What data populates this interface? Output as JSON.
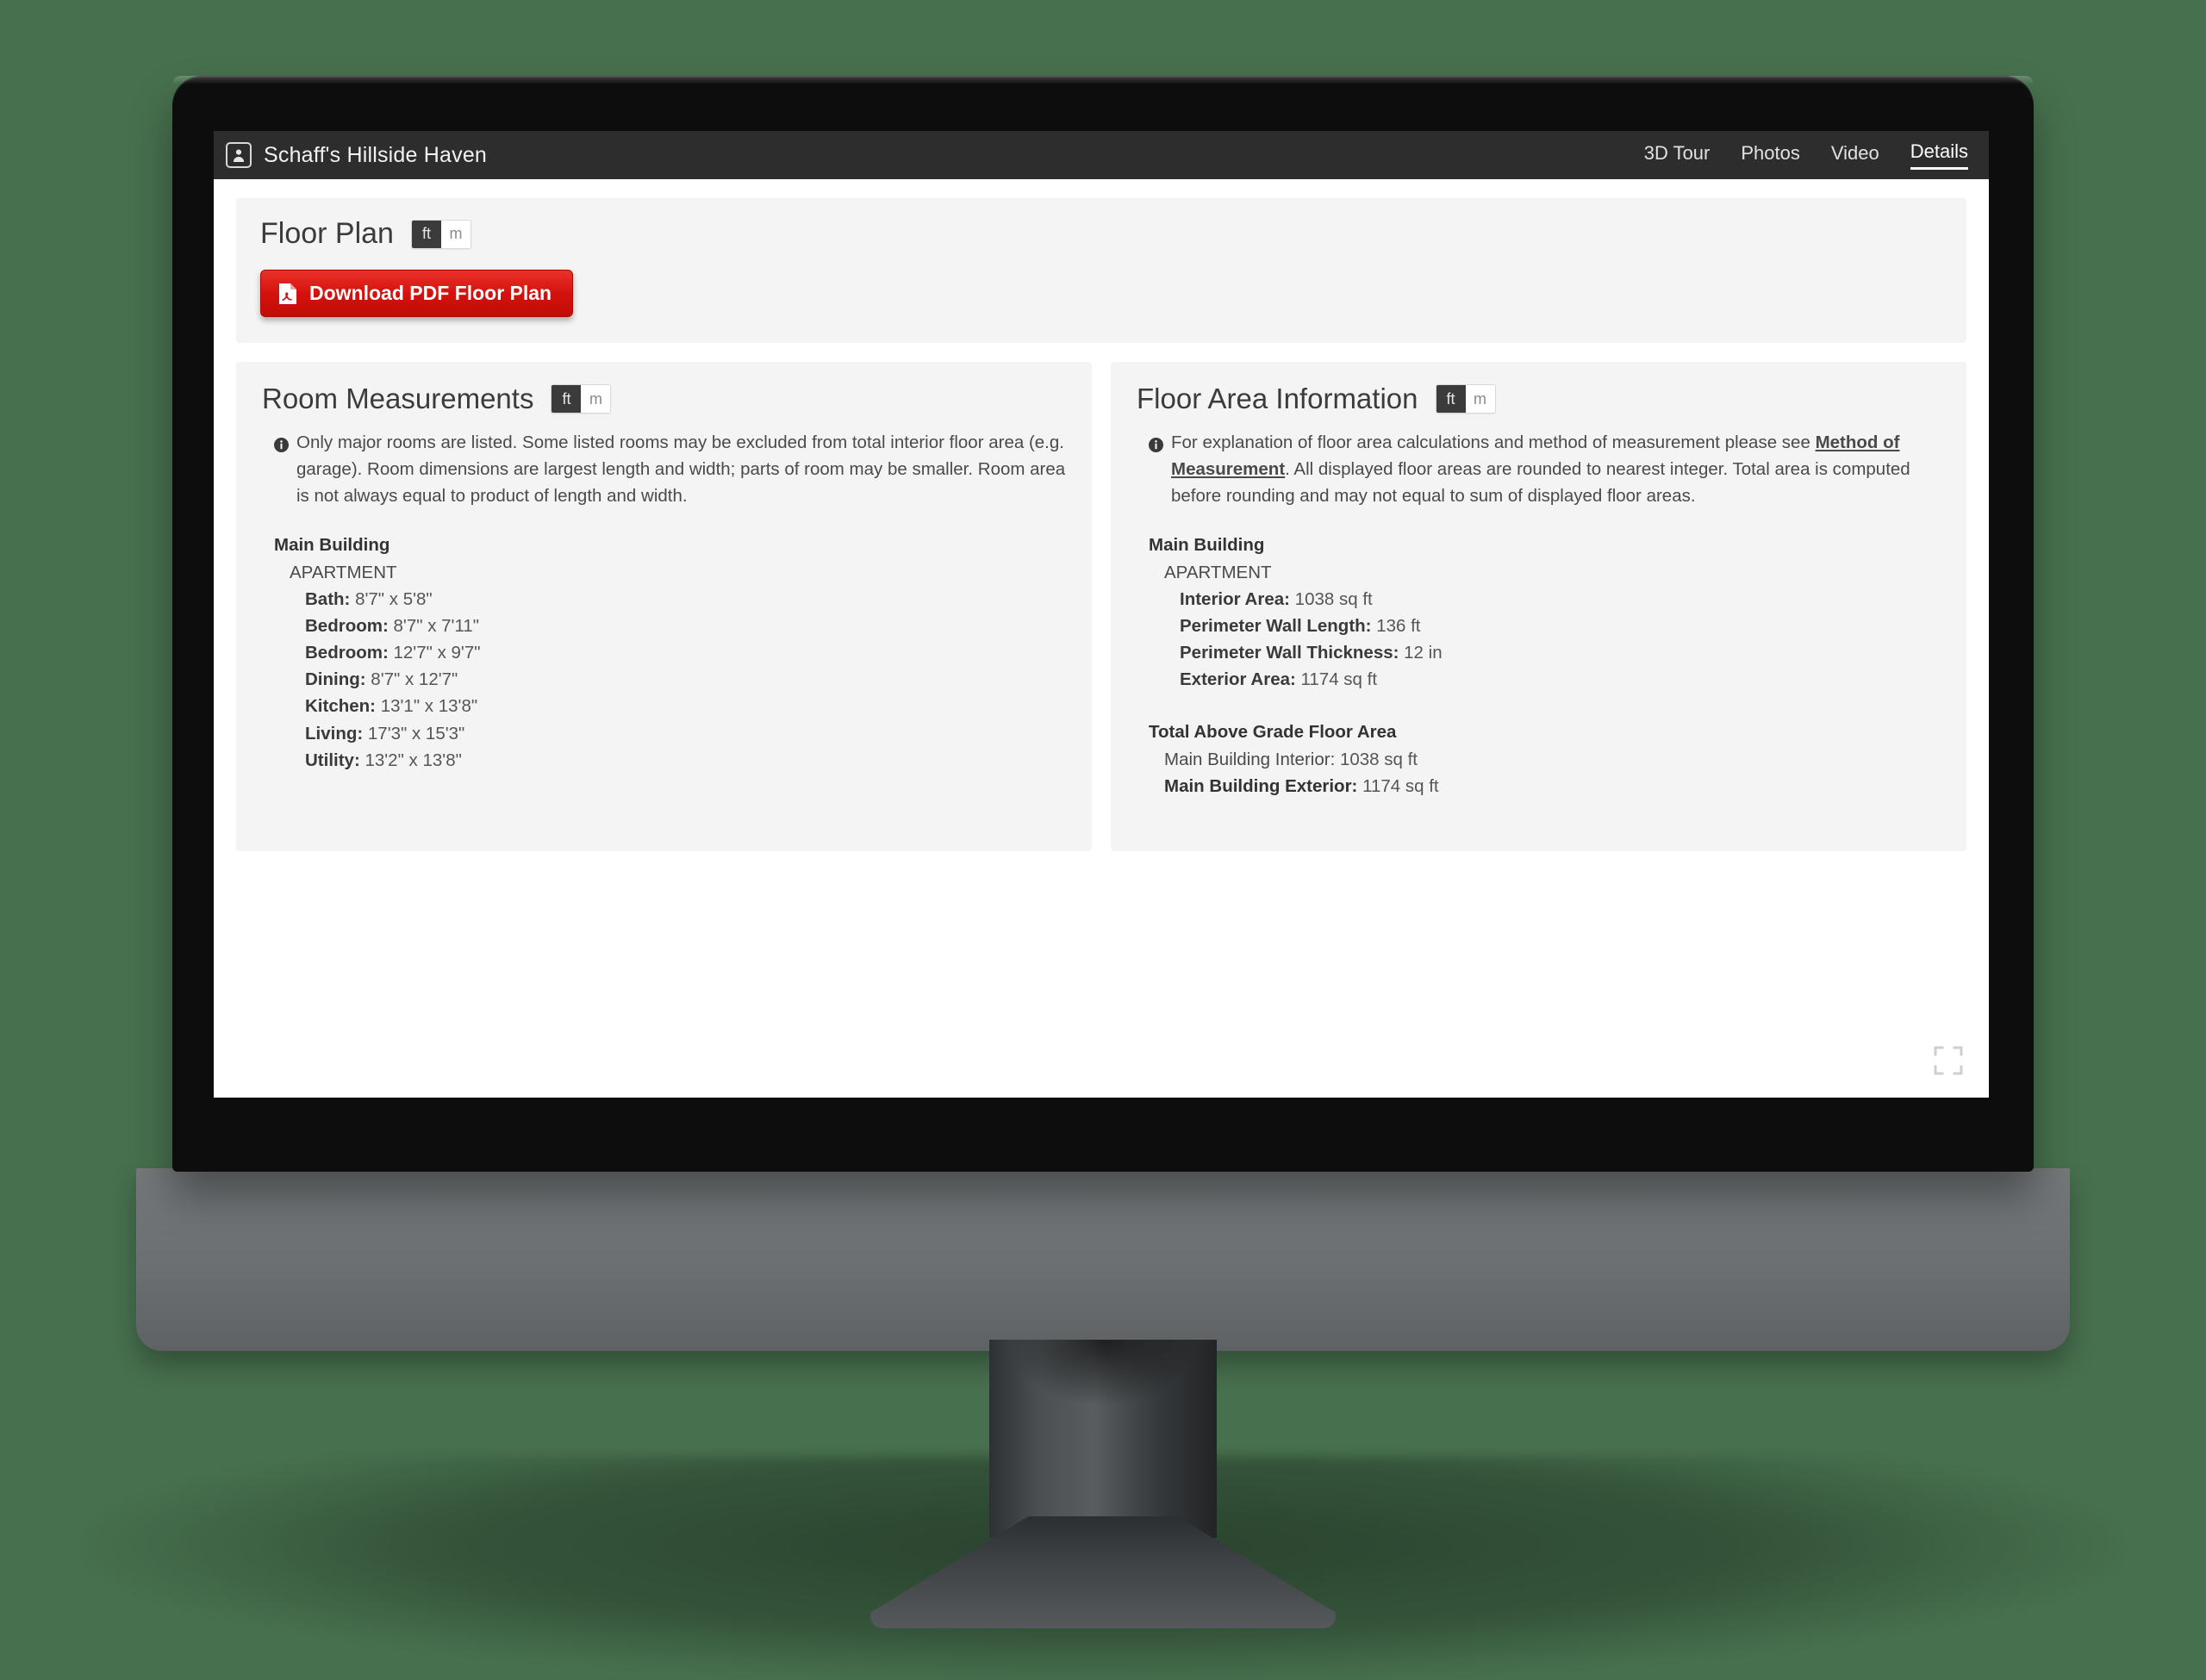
{
  "header": {
    "avatar_icon": "person-avatar-icon",
    "title": "Schaff's Hillside Haven",
    "nav": [
      {
        "label": "3D Tour",
        "active": false
      },
      {
        "label": "Photos",
        "active": false
      },
      {
        "label": "Video",
        "active": false
      },
      {
        "label": "Details",
        "active": true
      }
    ]
  },
  "floor_plan": {
    "title": "Floor Plan",
    "unit_toggle": {
      "ft": "ft",
      "m": "m",
      "selected": "ft"
    },
    "download_button": {
      "label": "Download PDF Floor Plan",
      "icon": "pdf-file-icon",
      "color": "#d4110c"
    }
  },
  "room_measurements": {
    "title": "Room Measurements",
    "unit_toggle": {
      "ft": "ft",
      "m": "m",
      "selected": "ft"
    },
    "note_icon": "info-icon",
    "note": "Only major rooms are listed. Some listed rooms may be excluded from total interior floor area (e.g. garage). Room dimensions are largest length and width; parts of room may be smaller. Room area is not always equal to product of length and width.",
    "building": "Main Building",
    "unit": "APARTMENT",
    "rooms": [
      {
        "name": "Bath",
        "dimensions": "8'7\" x 5'8\""
      },
      {
        "name": "Bedroom",
        "dimensions": "8'7\" x 7'11\""
      },
      {
        "name": "Bedroom",
        "dimensions": "12'7\" x 9'7\""
      },
      {
        "name": "Dining",
        "dimensions": "8'7\" x 12'7\""
      },
      {
        "name": "Kitchen",
        "dimensions": "13'1\" x 13'8\""
      },
      {
        "name": "Living",
        "dimensions": "17'3\" x 15'3\""
      },
      {
        "name": "Utility",
        "dimensions": "13'2\" x 13'8\""
      }
    ]
  },
  "floor_area": {
    "title": "Floor Area Information",
    "unit_toggle": {
      "ft": "ft",
      "m": "m",
      "selected": "ft"
    },
    "note_icon": "info-icon",
    "note_part1": "For explanation of floor area calculations and method of measurement please see ",
    "note_link": "Method of Measurement",
    "note_part2": ". All displayed floor areas are rounded to nearest integer. Total area is computed before rounding and may not equal to sum of displayed floor areas.",
    "building": "Main Building",
    "unit": "APARTMENT",
    "metrics": [
      {
        "name": "Interior Area",
        "value": "1038 sq ft"
      },
      {
        "name": "Perimeter Wall Length",
        "value": "136 ft"
      },
      {
        "name": "Perimeter Wall Thickness",
        "value": "12 in"
      },
      {
        "name": "Exterior Area",
        "value": "1174 sq ft"
      }
    ],
    "total_heading": "Total Above Grade Floor Area",
    "totals": [
      {
        "name": "Main Building Interior",
        "value": "1038 sq ft",
        "bold": false
      },
      {
        "name": "Main Building Exterior",
        "value": "1174 sq ft",
        "bold": true
      }
    ]
  },
  "fullscreen_icon": "fullscreen-expand-icon"
}
